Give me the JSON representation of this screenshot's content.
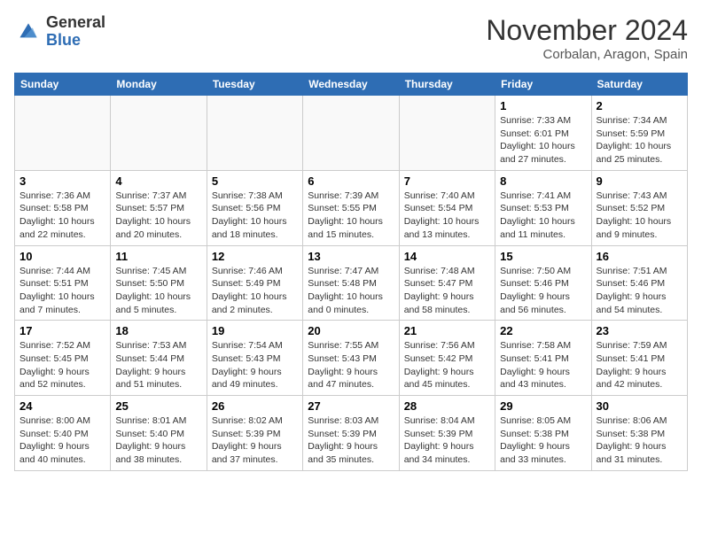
{
  "header": {
    "logo_line1": "General",
    "logo_line2": "Blue",
    "month_title": "November 2024",
    "location": "Corbalan, Aragon, Spain"
  },
  "weekdays": [
    "Sunday",
    "Monday",
    "Tuesday",
    "Wednesday",
    "Thursday",
    "Friday",
    "Saturday"
  ],
  "weeks": [
    [
      {
        "day": "",
        "info": ""
      },
      {
        "day": "",
        "info": ""
      },
      {
        "day": "",
        "info": ""
      },
      {
        "day": "",
        "info": ""
      },
      {
        "day": "",
        "info": ""
      },
      {
        "day": "1",
        "info": "Sunrise: 7:33 AM\nSunset: 6:01 PM\nDaylight: 10 hours and 27 minutes."
      },
      {
        "day": "2",
        "info": "Sunrise: 7:34 AM\nSunset: 5:59 PM\nDaylight: 10 hours and 25 minutes."
      }
    ],
    [
      {
        "day": "3",
        "info": "Sunrise: 7:36 AM\nSunset: 5:58 PM\nDaylight: 10 hours and 22 minutes."
      },
      {
        "day": "4",
        "info": "Sunrise: 7:37 AM\nSunset: 5:57 PM\nDaylight: 10 hours and 20 minutes."
      },
      {
        "day": "5",
        "info": "Sunrise: 7:38 AM\nSunset: 5:56 PM\nDaylight: 10 hours and 18 minutes."
      },
      {
        "day": "6",
        "info": "Sunrise: 7:39 AM\nSunset: 5:55 PM\nDaylight: 10 hours and 15 minutes."
      },
      {
        "day": "7",
        "info": "Sunrise: 7:40 AM\nSunset: 5:54 PM\nDaylight: 10 hours and 13 minutes."
      },
      {
        "day": "8",
        "info": "Sunrise: 7:41 AM\nSunset: 5:53 PM\nDaylight: 10 hours and 11 minutes."
      },
      {
        "day": "9",
        "info": "Sunrise: 7:43 AM\nSunset: 5:52 PM\nDaylight: 10 hours and 9 minutes."
      }
    ],
    [
      {
        "day": "10",
        "info": "Sunrise: 7:44 AM\nSunset: 5:51 PM\nDaylight: 10 hours and 7 minutes."
      },
      {
        "day": "11",
        "info": "Sunrise: 7:45 AM\nSunset: 5:50 PM\nDaylight: 10 hours and 5 minutes."
      },
      {
        "day": "12",
        "info": "Sunrise: 7:46 AM\nSunset: 5:49 PM\nDaylight: 10 hours and 2 minutes."
      },
      {
        "day": "13",
        "info": "Sunrise: 7:47 AM\nSunset: 5:48 PM\nDaylight: 10 hours and 0 minutes."
      },
      {
        "day": "14",
        "info": "Sunrise: 7:48 AM\nSunset: 5:47 PM\nDaylight: 9 hours and 58 minutes."
      },
      {
        "day": "15",
        "info": "Sunrise: 7:50 AM\nSunset: 5:46 PM\nDaylight: 9 hours and 56 minutes."
      },
      {
        "day": "16",
        "info": "Sunrise: 7:51 AM\nSunset: 5:46 PM\nDaylight: 9 hours and 54 minutes."
      }
    ],
    [
      {
        "day": "17",
        "info": "Sunrise: 7:52 AM\nSunset: 5:45 PM\nDaylight: 9 hours and 52 minutes."
      },
      {
        "day": "18",
        "info": "Sunrise: 7:53 AM\nSunset: 5:44 PM\nDaylight: 9 hours and 51 minutes."
      },
      {
        "day": "19",
        "info": "Sunrise: 7:54 AM\nSunset: 5:43 PM\nDaylight: 9 hours and 49 minutes."
      },
      {
        "day": "20",
        "info": "Sunrise: 7:55 AM\nSunset: 5:43 PM\nDaylight: 9 hours and 47 minutes."
      },
      {
        "day": "21",
        "info": "Sunrise: 7:56 AM\nSunset: 5:42 PM\nDaylight: 9 hours and 45 minutes."
      },
      {
        "day": "22",
        "info": "Sunrise: 7:58 AM\nSunset: 5:41 PM\nDaylight: 9 hours and 43 minutes."
      },
      {
        "day": "23",
        "info": "Sunrise: 7:59 AM\nSunset: 5:41 PM\nDaylight: 9 hours and 42 minutes."
      }
    ],
    [
      {
        "day": "24",
        "info": "Sunrise: 8:00 AM\nSunset: 5:40 PM\nDaylight: 9 hours and 40 minutes."
      },
      {
        "day": "25",
        "info": "Sunrise: 8:01 AM\nSunset: 5:40 PM\nDaylight: 9 hours and 38 minutes."
      },
      {
        "day": "26",
        "info": "Sunrise: 8:02 AM\nSunset: 5:39 PM\nDaylight: 9 hours and 37 minutes."
      },
      {
        "day": "27",
        "info": "Sunrise: 8:03 AM\nSunset: 5:39 PM\nDaylight: 9 hours and 35 minutes."
      },
      {
        "day": "28",
        "info": "Sunrise: 8:04 AM\nSunset: 5:39 PM\nDaylight: 9 hours and 34 minutes."
      },
      {
        "day": "29",
        "info": "Sunrise: 8:05 AM\nSunset: 5:38 PM\nDaylight: 9 hours and 33 minutes."
      },
      {
        "day": "30",
        "info": "Sunrise: 8:06 AM\nSunset: 5:38 PM\nDaylight: 9 hours and 31 minutes."
      }
    ]
  ]
}
